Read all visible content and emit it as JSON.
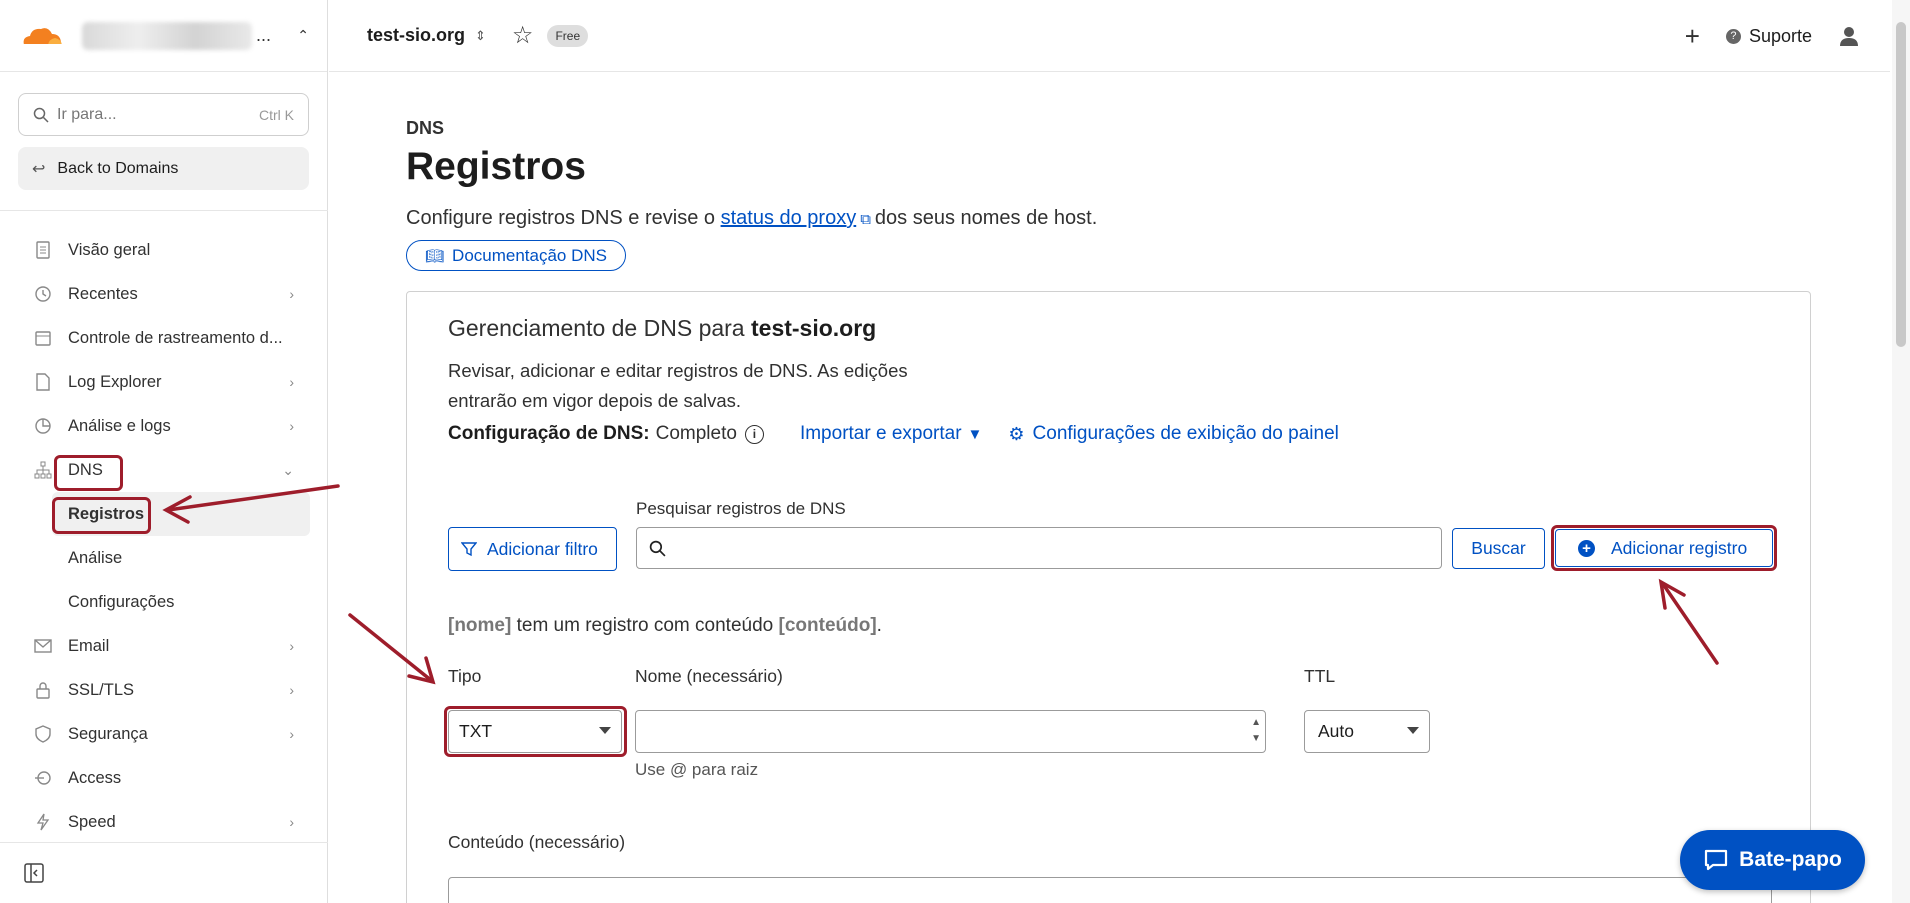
{
  "sidebar": {
    "search_placeholder": "Ir para...",
    "search_shortcut": "Ctrl K",
    "back_label": "Back to Domains",
    "items": [
      {
        "label": "Visão geral"
      },
      {
        "label": "Recentes"
      },
      {
        "label": "Controle de rastreamento d..."
      },
      {
        "label": "Log Explorer"
      },
      {
        "label": "Análise e logs"
      },
      {
        "label": "DNS"
      },
      {
        "label": "Email"
      },
      {
        "label": "SSL/TLS"
      },
      {
        "label": "Segurança"
      },
      {
        "label": "Access"
      },
      {
        "label": "Speed"
      }
    ],
    "dns_sub": [
      {
        "label": "Registros"
      },
      {
        "label": "Análise"
      },
      {
        "label": "Configurações"
      }
    ]
  },
  "topbar": {
    "domain": "test-sio.org",
    "plan_badge": "Free",
    "support_label": "Suporte"
  },
  "page": {
    "crumb": "DNS",
    "title": "Registros",
    "desc_before": "Configure registros DNS e revise o",
    "desc_link": "status do proxy",
    "desc_after": "dos seus nomes de host.",
    "doc_button": "Documentação DNS"
  },
  "card": {
    "title_prefix": "Gerenciamento de DNS para",
    "title_domain": "test-sio.org",
    "desc": "Revisar, adicionar e editar registros de DNS. As edições entrarão em vigor depois de salvas.",
    "config_label": "Configuração de DNS:",
    "config_value": "Completo",
    "import_export": "Importar e exportar",
    "display_settings": "Configurações de exibição do painel",
    "search_label": "Pesquisar registros de DNS",
    "filter_button": "Adicionar filtro",
    "search_button": "Buscar",
    "add_button": "Adicionar registro",
    "hint_name": "[nome]",
    "hint_mid": "tem um registro com conteúdo",
    "hint_content": "[conteúdo]",
    "hint_end": ".",
    "type_label": "Tipo",
    "type_value": "TXT",
    "name_label": "Nome (necessário)",
    "name_value": "",
    "name_hint": "Use @ para raiz",
    "ttl_label": "TTL",
    "ttl_value": "Auto",
    "content_label": "Conteúdo (necessário)"
  },
  "chat": {
    "label": "Bate-papo"
  },
  "colors": {
    "accent": "#0051c3",
    "annotation": "#9e1d2b",
    "logo": "#f38020"
  }
}
